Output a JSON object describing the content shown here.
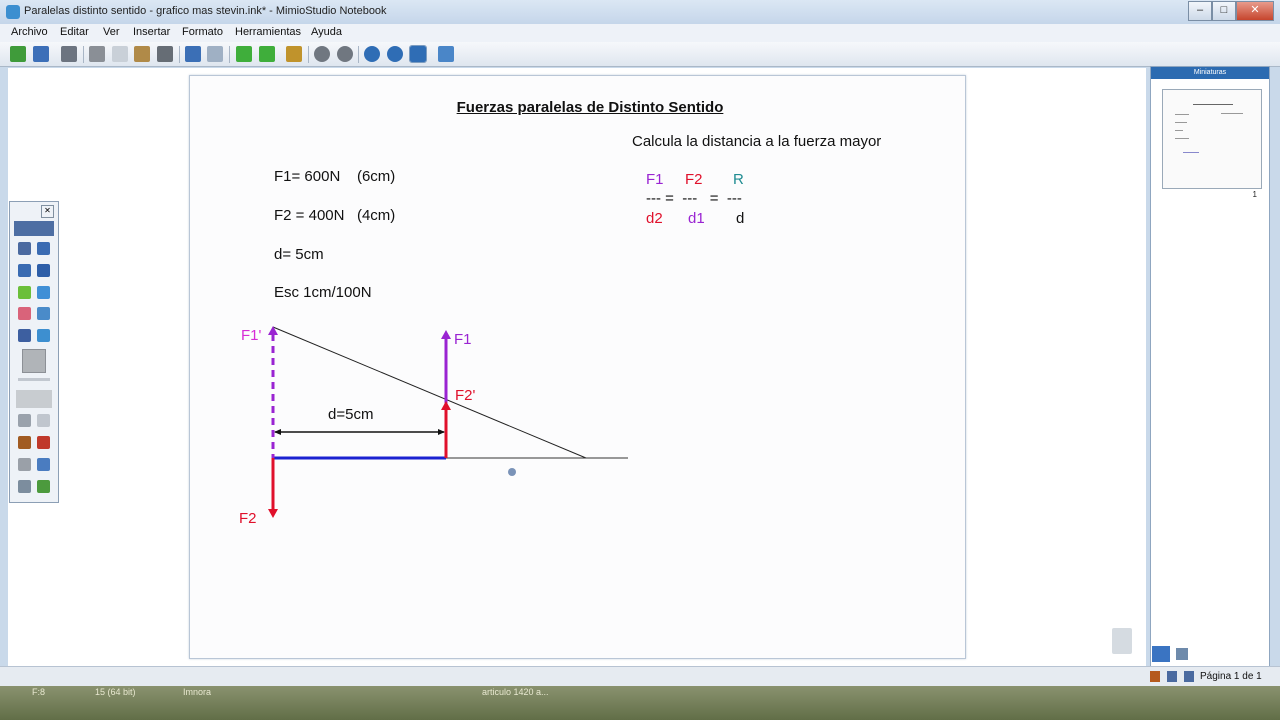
{
  "window": {
    "title": "Paralelas distinto sentido - grafico mas stevin.ink* - MimioStudio Notebook",
    "buttons": [
      "minimize",
      "maximize",
      "close"
    ]
  },
  "menu": [
    "Archivo",
    "Editar",
    "Ver",
    "Insertar",
    "Formato",
    "Herramientas",
    "Ayuda"
  ],
  "toolbar_icons": [
    "open-icon",
    "save-icon",
    "print-icon",
    "cut-icon",
    "copy-icon",
    "paste-icon",
    "delete-icon",
    "undo-icon",
    "redo-icon",
    "new-page-icon",
    "duplicate-page-icon",
    "users-icon",
    "back-icon",
    "forward-icon",
    "zoom-in-icon",
    "zoom-out-icon",
    "zoom-fit-icon",
    "screen-icon"
  ],
  "page": {
    "title": "Fuerzas paralelas de Distinto Sentido",
    "task": "Calcula la distancia a la fuerza mayor",
    "givens": [
      "F1= 600N    (6cm)",
      "F2 = 400N   (4cm)",
      "d= 5cm",
      "Esc 1cm/100N"
    ],
    "formula": {
      "num": [
        "F1",
        "F2",
        "R"
      ],
      "sep": "--- =  ---   =  ---",
      "den": [
        "d2",
        "d1",
        "d"
      ]
    },
    "diagram_labels": {
      "f1_prime": "F1'",
      "f1": "F1",
      "f2_prime": "F2'",
      "f2": "F2",
      "distance": "d=5cm"
    }
  },
  "colors": {
    "purple": "#9a24d2",
    "red": "#e0102b",
    "teal": "#1f8c92",
    "blue": "#1b22d1",
    "magenta": "#d72ad6"
  },
  "thumbnails": {
    "header": "Miniaturas",
    "number": "1"
  },
  "status": {
    "page": "Página 1 de 1"
  },
  "taskbar": [
    "F:8",
    "15 (64 bit)",
    "Imnora",
    "articulo 1420 a..."
  ]
}
